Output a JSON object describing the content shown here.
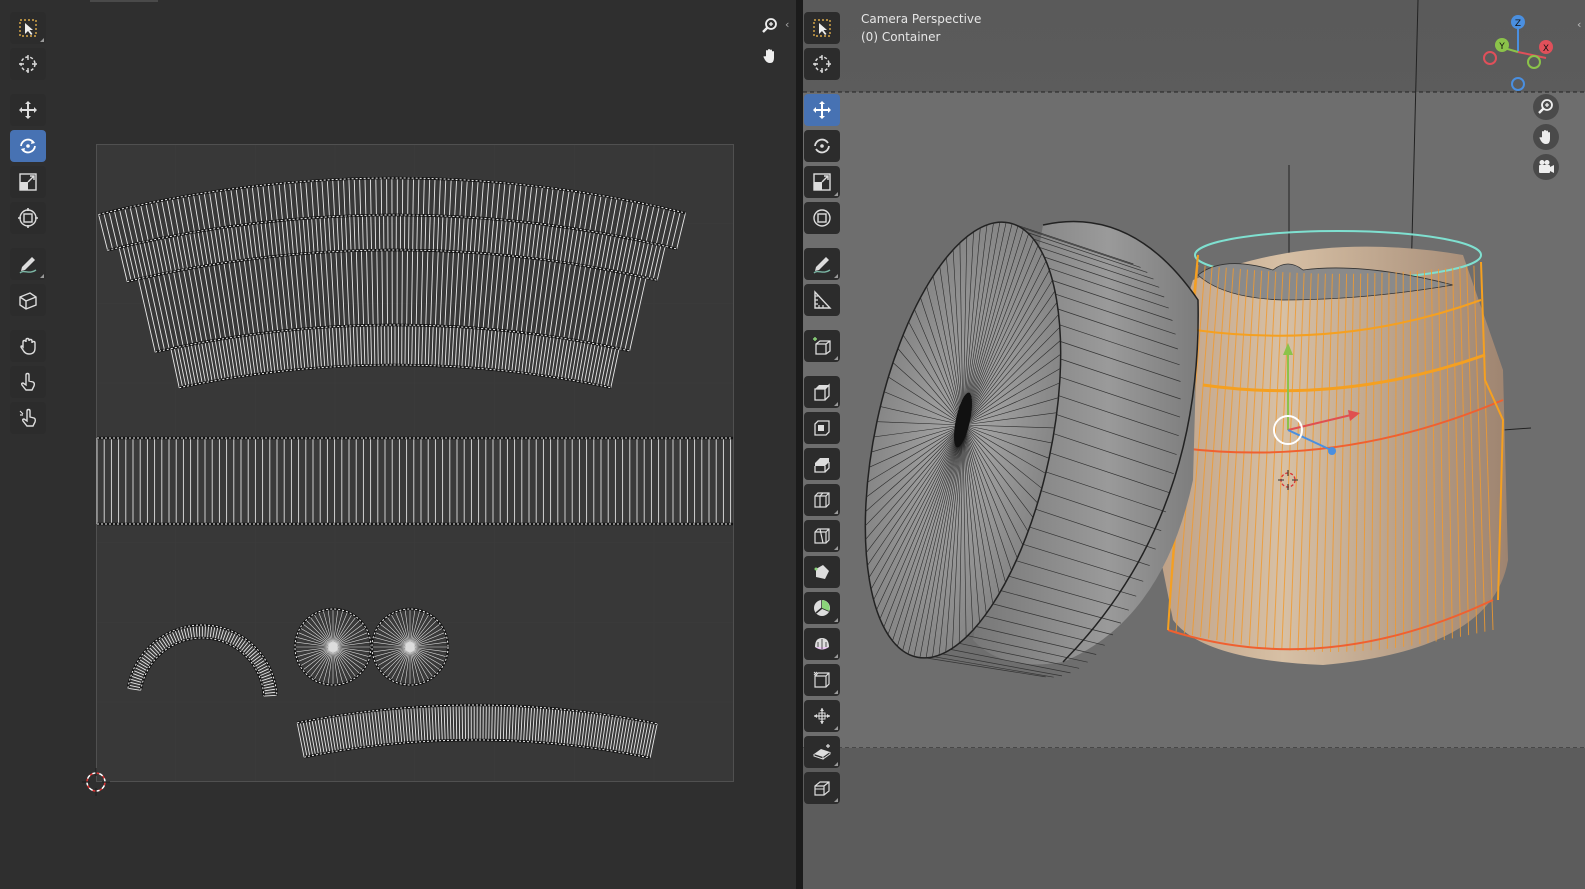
{
  "viewport": {
    "camera_label": "Camera Perspective",
    "object_label": "(0) Container"
  },
  "gizmo": {
    "x": "X",
    "y": "Y",
    "z": "Z"
  },
  "colors": {
    "active_tool": "#4772b3",
    "selection_orange": "#f0a030",
    "edge_teal": "#7fe0d0",
    "axis_x": "#e0505a",
    "axis_y": "#8bc34a",
    "axis_z": "#4a8fe0"
  },
  "uv_toolbar": [
    "select-box-icon",
    "cursor-icon",
    "move-icon",
    "rotate-icon",
    "scale-icon",
    "transform-icon",
    "annotate-icon",
    "uv-sculpt-icon",
    "grab-icon",
    "relax-icon",
    "pinch-icon"
  ],
  "viewport_toolbar": [
    "select-box-icon",
    "cursor-icon",
    "move-icon",
    "rotate-icon",
    "scale-icon",
    "transform-icon",
    "annotate-icon",
    "measure-icon",
    "add-cube-icon",
    "extrude-icon",
    "inset-icon",
    "bevel-icon",
    "loop-cut-icon",
    "knife-icon",
    "poly-build-icon",
    "spin-icon",
    "smooth-icon",
    "edge-slide-icon",
    "shrink-fatten-icon",
    "shear-icon",
    "rip-icon"
  ]
}
